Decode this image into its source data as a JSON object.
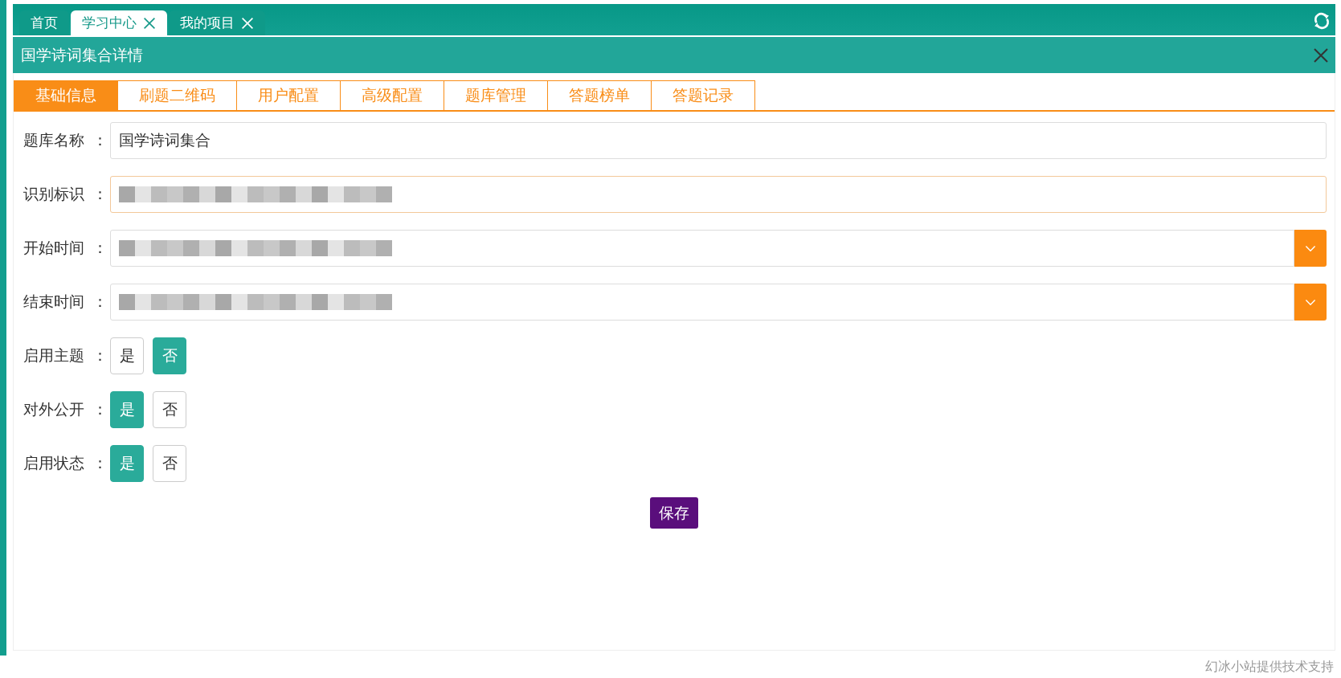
{
  "top_tabs": [
    {
      "label": "首页",
      "selected": false,
      "closable": false
    },
    {
      "label": "学习中心",
      "selected": true,
      "closable": true
    },
    {
      "label": "我的项目",
      "selected": false,
      "closable": true
    }
  ],
  "panel": {
    "title": "国学诗词集合详情"
  },
  "tabs": [
    {
      "label": "基础信息",
      "selected": true
    },
    {
      "label": "刷题二维码",
      "selected": false
    },
    {
      "label": "用户配置",
      "selected": false
    },
    {
      "label": "高级配置",
      "selected": false
    },
    {
      "label": "题库管理",
      "selected": false
    },
    {
      "label": "答题榜单",
      "selected": false
    },
    {
      "label": "答题记录",
      "selected": false
    }
  ],
  "fields": [
    {
      "kind": "text",
      "label": "题库名称",
      "separator": "：",
      "value": "国学诗词集合",
      "focused": false
    },
    {
      "kind": "text",
      "label": "识别标识",
      "separator": "：",
      "redacted": true,
      "focused": true
    },
    {
      "kind": "date",
      "label": "开始时间",
      "separator": "：",
      "redacted": true
    },
    {
      "kind": "date",
      "label": "结束时间",
      "separator": "：",
      "redacted": true
    },
    {
      "kind": "toggle",
      "label": "启用主题",
      "separator": "：",
      "options": [
        {
          "label": "是",
          "selected": false
        },
        {
          "label": "否",
          "selected": true
        }
      ]
    },
    {
      "kind": "toggle",
      "label": "对外公开",
      "separator": "：",
      "options": [
        {
          "label": "是",
          "selected": true
        },
        {
          "label": "否",
          "selected": false
        }
      ]
    },
    {
      "kind": "toggle",
      "label": "启用状态",
      "separator": "：",
      "options": [
        {
          "label": "是",
          "selected": true
        },
        {
          "label": "否",
          "selected": false
        }
      ]
    }
  ],
  "save_button": "保存",
  "footer": "幻冰小站提供技术支持"
}
